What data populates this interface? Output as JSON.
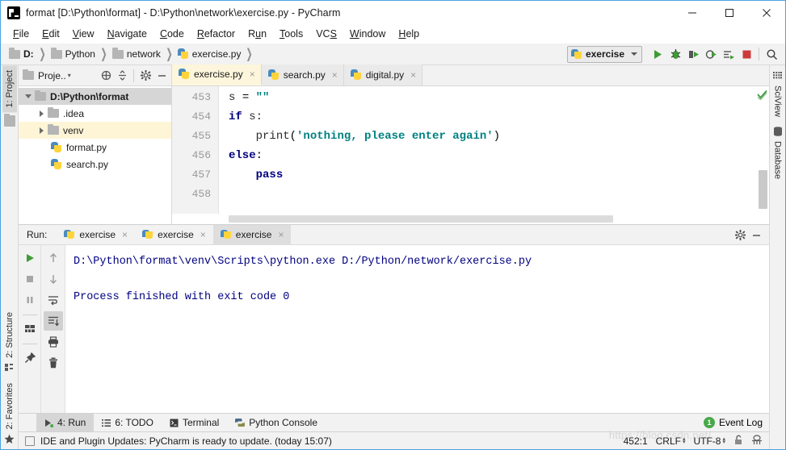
{
  "window": {
    "title": "format [D:\\Python\\format] - D:\\Python\\network\\exercise.py - PyCharm",
    "app_icon": "pycharm-logo-icon",
    "controls": {
      "minimize": "minimize-icon",
      "maximize": "maximize-icon",
      "close": "close-icon"
    }
  },
  "menubar": {
    "items": [
      {
        "label": "File",
        "mnemonic": "F"
      },
      {
        "label": "Edit",
        "mnemonic": "E"
      },
      {
        "label": "View",
        "mnemonic": "V"
      },
      {
        "label": "Navigate",
        "mnemonic": "N"
      },
      {
        "label": "Code",
        "mnemonic": "C"
      },
      {
        "label": "Refactor",
        "mnemonic": "R"
      },
      {
        "label": "Run",
        "mnemonic": "u"
      },
      {
        "label": "Tools",
        "mnemonic": "T"
      },
      {
        "label": "VCS",
        "mnemonic": "S"
      },
      {
        "label": "Window",
        "mnemonic": "W"
      },
      {
        "label": "Help",
        "mnemonic": "H"
      }
    ]
  },
  "breadcrumb": {
    "items": [
      {
        "label": "D:",
        "icon": "folder-icon",
        "bold": true
      },
      {
        "label": "Python",
        "icon": "folder-icon",
        "bold": false
      },
      {
        "label": "network",
        "icon": "folder-icon",
        "bold": false
      },
      {
        "label": "exercise.py",
        "icon": "python-file-icon",
        "bold": false
      }
    ]
  },
  "toolbar": {
    "run_config": {
      "label": "exercise",
      "icon": "python-config-icon",
      "dropdown": "chevron-down-icon"
    },
    "buttons": [
      {
        "name": "run-button",
        "icon": "run-icon"
      },
      {
        "name": "debug-button",
        "icon": "debug-bug-icon"
      },
      {
        "name": "run-coverage-button",
        "icon": "coverage-icon"
      },
      {
        "name": "profile-button",
        "icon": "profile-icon"
      },
      {
        "name": "run-with-console-button",
        "icon": "run-console-icon"
      },
      {
        "name": "stop-button",
        "icon": "stop-red-icon"
      },
      {
        "name": "search-everywhere-button",
        "icon": "search-icon"
      }
    ]
  },
  "left_stripe": {
    "top": [
      {
        "label": "1: Project",
        "mnemonic": "1",
        "icon": "project-folder-icon",
        "active": true
      }
    ],
    "bottom": [
      {
        "label": "2: Structure",
        "mnemonic": "2",
        "icon": "structure-icon",
        "active": false
      },
      {
        "label": "2: Favorites",
        "mnemonic": "2",
        "icon": "star-icon",
        "active": false
      }
    ]
  },
  "right_stripe": {
    "items": [
      {
        "label": "SciView",
        "icon": "sciview-grid-icon"
      },
      {
        "label": "Database",
        "icon": "database-icon"
      }
    ]
  },
  "project_panel": {
    "title": "Proje..",
    "header_icons": [
      {
        "name": "scroll-from-source-icon"
      },
      {
        "name": "collapse-all-icon"
      },
      {
        "name": "gear-icon"
      },
      {
        "name": "hide-panel-icon"
      }
    ],
    "tree": [
      {
        "label": "D:\\Python\\format",
        "icon": "folder-icon",
        "arrow": "down",
        "indent": 0,
        "bold": true,
        "state": "selected"
      },
      {
        "label": ".idea",
        "icon": "folder-icon",
        "arrow": "right",
        "indent": 1,
        "bold": false,
        "state": "normal"
      },
      {
        "label": "venv",
        "icon": "folder-icon",
        "arrow": "right",
        "indent": 1,
        "bold": false,
        "state": "highlighted"
      },
      {
        "label": "format.py",
        "icon": "python-file-icon",
        "arrow": "none",
        "indent": 2,
        "bold": false,
        "state": "normal"
      },
      {
        "label": "search.py",
        "icon": "python-file-icon",
        "arrow": "none",
        "indent": 2,
        "bold": false,
        "state": "normal"
      }
    ]
  },
  "editor": {
    "tabs": [
      {
        "label": "exercise.py",
        "icon": "python-file-icon",
        "active": true,
        "close": "×"
      },
      {
        "label": "search.py",
        "icon": "python-file-icon",
        "active": false,
        "close": "×"
      },
      {
        "label": "digital.py",
        "icon": "python-file-icon",
        "active": false,
        "close": "×"
      }
    ],
    "inspection_status": "ok-check-icon",
    "line_numbers": [
      "453",
      "454",
      "455",
      "456",
      "457",
      "458"
    ],
    "code_lines": [
      [
        {
          "t": "s ",
          "c": "var"
        },
        {
          "t": "= ",
          "c": "pl"
        },
        {
          "t": "\"\"",
          "c": "str"
        }
      ],
      [
        {
          "t": "if",
          "c": "k"
        },
        {
          "t": " s:",
          "c": "var"
        }
      ],
      [
        {
          "t": "    ",
          "c": "pl"
        },
        {
          "t": "print",
          "c": "fn"
        },
        {
          "t": "(",
          "c": "pl"
        },
        {
          "t": "'nothing, please enter again'",
          "c": "str"
        },
        {
          "t": ")",
          "c": "pl"
        }
      ],
      [
        {
          "t": "else",
          "c": "k"
        },
        {
          "t": ":",
          "c": "pl"
        }
      ],
      [
        {
          "t": "    ",
          "c": "pl"
        },
        {
          "t": "pass",
          "c": "k"
        }
      ],
      [
        {
          "t": "",
          "c": "pl"
        }
      ]
    ]
  },
  "run_panel": {
    "label": "Run:",
    "tabs": [
      {
        "label": "exercise",
        "icon": "python-run-icon",
        "active": false,
        "close": "×"
      },
      {
        "label": "exercise",
        "icon": "python-run-icon",
        "active": false,
        "close": "×"
      },
      {
        "label": "exercise",
        "icon": "python-run-icon",
        "active": true,
        "close": "×"
      }
    ],
    "header_buttons": [
      {
        "name": "settings-gear-button",
        "icon": "gear-icon"
      },
      {
        "name": "hide-run-panel-button",
        "icon": "minimize-icon"
      }
    ],
    "left_toolbar": [
      {
        "name": "rerun-button",
        "icon": "run-green-icon"
      },
      {
        "name": "stop-button",
        "icon": "stop-square-icon"
      },
      {
        "name": "pause-button",
        "icon": "pause-icon"
      },
      {
        "name": "layout-button",
        "icon": "layout-icon"
      },
      {
        "name": "pin-tab-button",
        "icon": "pin-icon"
      }
    ],
    "right_toolbar": [
      {
        "name": "up-stack-trace-button",
        "icon": "arrow-up-icon"
      },
      {
        "name": "down-stack-trace-button",
        "icon": "arrow-down-icon"
      },
      {
        "name": "soft-wrap-button",
        "icon": "soft-wrap-icon"
      },
      {
        "name": "scroll-to-end-button",
        "icon": "scroll-to-end-icon",
        "pressed": true
      },
      {
        "name": "print-button",
        "icon": "printer-icon"
      },
      {
        "name": "clear-all-button",
        "icon": "trash-icon"
      }
    ],
    "console_lines": [
      "D:\\Python\\format\\venv\\Scripts\\python.exe D:/Python/network/exercise.py",
      "",
      "Process finished with exit code 0"
    ]
  },
  "bottom_toolbar": {
    "buttons": [
      {
        "label": "4: Run",
        "mnemonic": "4",
        "icon": "run-green-icon",
        "active": true
      },
      {
        "label": "6: TODO",
        "mnemonic": "6",
        "icon": "todo-list-icon",
        "active": false
      },
      {
        "label": "Terminal",
        "mnemonic": "",
        "icon": "terminal-icon",
        "active": false
      },
      {
        "label": "Python Console",
        "mnemonic": "",
        "icon": "python-console-icon",
        "active": false
      }
    ],
    "event_log": {
      "label": "Event Log",
      "count": "1"
    }
  },
  "status_bar": {
    "notification_icon": "notification-square-icon",
    "message": "IDE and Plugin Updates: PyCharm is ready to update. (today 15:07)",
    "caret_position": "452:1",
    "line_separator": "CRLF",
    "encoding": "UTF-8",
    "lock_icon": "unlocked-icon",
    "inspection_icon": "hector-inspector-icon",
    "watermark": "https://blog.csdn.net/..."
  },
  "colors": {
    "accent_border": "#4aa3df",
    "panel_bg": "#f2f2f2",
    "editor_bg": "#ffffff",
    "active_tab_bg": "#fdf6dc",
    "selection_bg": "#d6d6d6",
    "keyword": "#000080",
    "string": "#008080",
    "console_text": "#000080",
    "line_number": "#999999",
    "green_accent": "#49a849"
  }
}
